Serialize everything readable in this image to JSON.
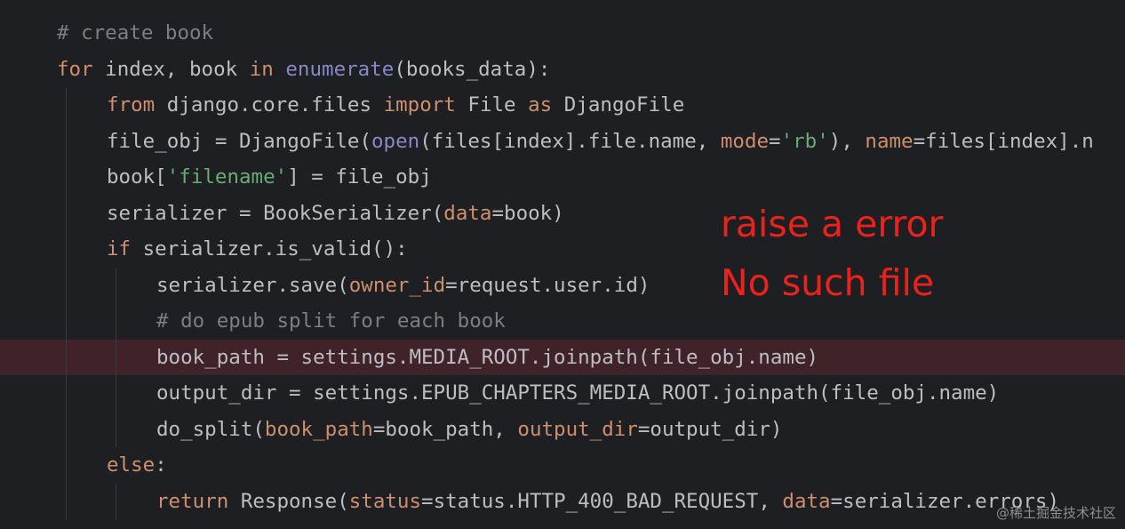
{
  "editor": {
    "colors": {
      "background": "#1e1f22",
      "error_line_background": "#3f2329",
      "keyword": "#cf8e6d",
      "comment": "#7a7e85",
      "string": "#6aab73",
      "builtin": "#8888c6",
      "parameter": "#cf8e6d",
      "text": "#bcbec4"
    },
    "lines": [
      {
        "indent": 1,
        "tokens": [
          {
            "t": "cm",
            "v": "# create book"
          }
        ]
      },
      {
        "indent": 1,
        "tokens": [
          {
            "t": "kw",
            "v": "for"
          },
          {
            "t": "tx",
            "v": " index, book "
          },
          {
            "t": "kw",
            "v": "in"
          },
          {
            "t": "tx",
            "v": " "
          },
          {
            "t": "bi",
            "v": "enumerate"
          },
          {
            "t": "tx",
            "v": "(books_data):"
          }
        ]
      },
      {
        "indent": 2,
        "tokens": [
          {
            "t": "kw",
            "v": "from"
          },
          {
            "t": "tx",
            "v": " django.core.files "
          },
          {
            "t": "kw",
            "v": "import"
          },
          {
            "t": "tx",
            "v": " File "
          },
          {
            "t": "kw",
            "v": "as"
          },
          {
            "t": "tx",
            "v": " DjangoFile"
          }
        ]
      },
      {
        "indent": 2,
        "tokens": [
          {
            "t": "tx",
            "v": "file_obj = DjangoFile("
          },
          {
            "t": "bi",
            "v": "open"
          },
          {
            "t": "tx",
            "v": "(files[index].file.name, "
          },
          {
            "t": "pr",
            "v": "mode"
          },
          {
            "t": "tx",
            "v": "="
          },
          {
            "t": "st",
            "v": "'rb'"
          },
          {
            "t": "tx",
            "v": "), "
          },
          {
            "t": "pr",
            "v": "name"
          },
          {
            "t": "tx",
            "v": "=files[index].n"
          }
        ]
      },
      {
        "indent": 2,
        "tokens": [
          {
            "t": "tx",
            "v": "book["
          },
          {
            "t": "st",
            "v": "'filename'"
          },
          {
            "t": "tx",
            "v": "] = file_obj"
          }
        ]
      },
      {
        "indent": 2,
        "tokens": [
          {
            "t": "tx",
            "v": "serializer = BookSerializer("
          },
          {
            "t": "pr",
            "v": "data"
          },
          {
            "t": "tx",
            "v": "=book)"
          }
        ]
      },
      {
        "indent": 2,
        "tokens": [
          {
            "t": "kw",
            "v": "if"
          },
          {
            "t": "tx",
            "v": " serializer.is_valid():"
          }
        ]
      },
      {
        "indent": 3,
        "tokens": [
          {
            "t": "tx",
            "v": "serializer.save("
          },
          {
            "t": "pr",
            "v": "owner_id"
          },
          {
            "t": "tx",
            "v": "=request.user.id)"
          }
        ]
      },
      {
        "indent": 3,
        "tokens": [
          {
            "t": "cm",
            "v": "# do epub split for each book"
          }
        ]
      },
      {
        "indent": 3,
        "error": true,
        "tokens": [
          {
            "t": "tx",
            "v": "book_path = settings.MEDIA_ROOT.joinpath(file_obj.name)"
          }
        ]
      },
      {
        "indent": 3,
        "tokens": [
          {
            "t": "tx",
            "v": "output_dir = settings.EPUB_CHAPTERS_MEDIA_ROOT.joinpath(file_obj.name)"
          }
        ]
      },
      {
        "indent": 3,
        "tokens": [
          {
            "t": "tx",
            "v": "do_split("
          },
          {
            "t": "pr",
            "v": "book_path"
          },
          {
            "t": "tx",
            "v": "=book_path, "
          },
          {
            "t": "pr",
            "v": "output_dir"
          },
          {
            "t": "tx",
            "v": "=output_dir)"
          }
        ]
      },
      {
        "indent": 2,
        "tokens": [
          {
            "t": "kw",
            "v": "else"
          },
          {
            "t": "tx",
            "v": ":"
          }
        ]
      },
      {
        "indent": 3,
        "tokens": [
          {
            "t": "kw",
            "v": "return"
          },
          {
            "t": "tx",
            "v": " Response("
          },
          {
            "t": "pr",
            "v": "status"
          },
          {
            "t": "tx",
            "v": "=status.HTTP_400_BAD_REQUEST, "
          },
          {
            "t": "pr",
            "v": "data"
          },
          {
            "t": "tx",
            "v": "=serializer.errors)"
          }
        ]
      }
    ]
  },
  "annotation": {
    "line1": "raise a error",
    "line2": "No such file",
    "color": "#e8221c"
  },
  "watermark": "@稀土掘金技术社区"
}
